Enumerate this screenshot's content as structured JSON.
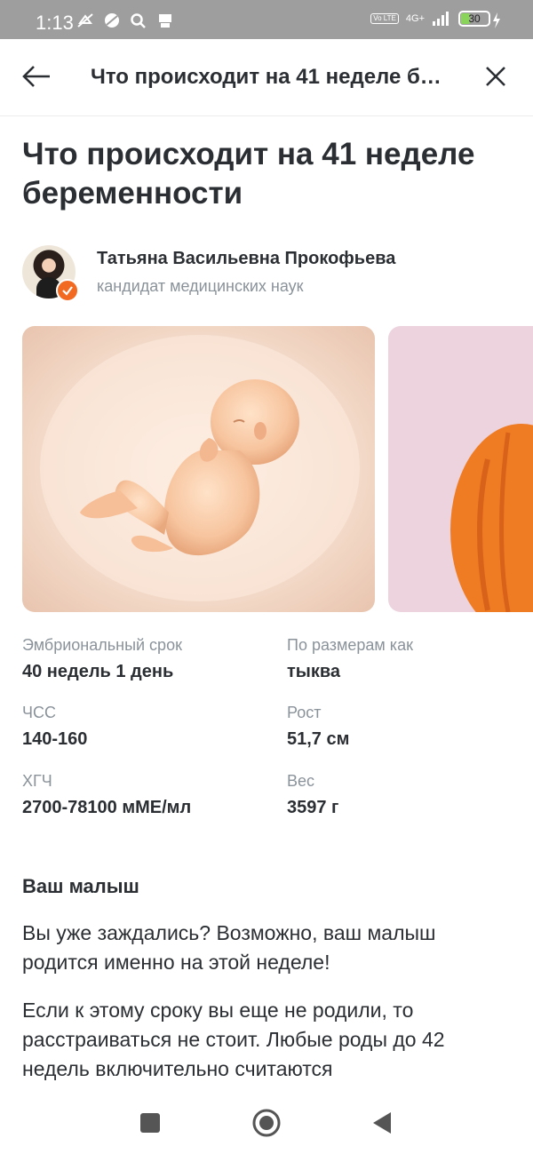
{
  "status_bar": {
    "time": "1:13",
    "volte": "Vo LTE",
    "network": "4G+",
    "battery": "30",
    "battery_level_fraction": 0.3
  },
  "header": {
    "title": "Что происходит на 41 неделе б…",
    "back_icon": "arrow-left-icon",
    "close_icon": "close-icon"
  },
  "article": {
    "title": "Что происходит на 41 неделе беременности",
    "author": {
      "name": "Татьяна Васильевна Прокофьева",
      "credential": "кандидат медицинских наук"
    },
    "stats": [
      {
        "label": "Эмбриональный срок",
        "value": "40 недель 1 день"
      },
      {
        "label": "По размерам как",
        "value": "тыква"
      },
      {
        "label": "ЧСС",
        "value": "140-160"
      },
      {
        "label": "Рост",
        "value": "51,7 см"
      },
      {
        "label": "ХГЧ",
        "value": "2700-78100 мМЕ/мл"
      },
      {
        "label": "Вес",
        "value": "3597 г"
      }
    ],
    "section_heading": "Ваш малыш",
    "paragraphs": [
      "Вы уже заждались? Возможно, ваш малыш родится именно на этой неделе!",
      "Если к этому сроку вы еще не родили, то расстраиваться не стоит. Любые роды до 42 недель включительно считаются своевременными"
    ]
  },
  "colors": {
    "accent": "#f26a22",
    "text": "#2b2f33",
    "muted": "#8a929a",
    "status_bar": "#9e9e9e"
  }
}
